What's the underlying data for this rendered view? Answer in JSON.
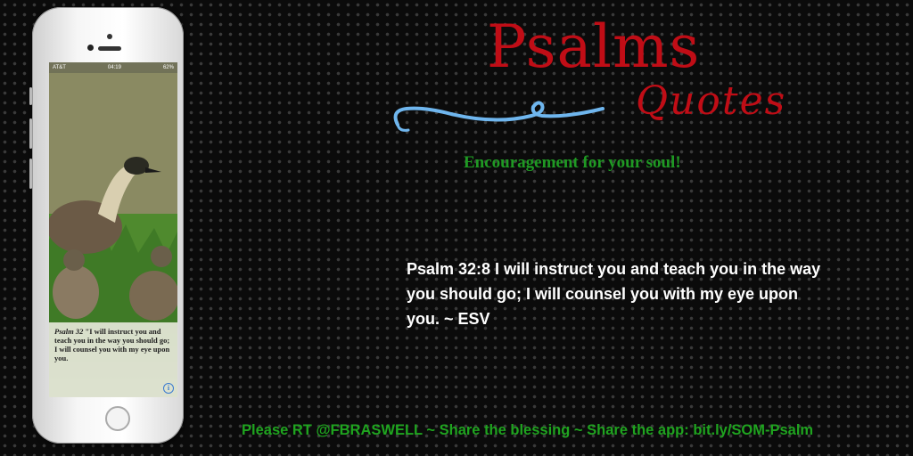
{
  "phone": {
    "carrier": "AT&T",
    "time": "04:19",
    "battery": "62%",
    "caption_ref": "Psalm 32",
    "caption_text": "\"I will instruct you and teach you in the way you should go; I will counsel you with my eye upon you.",
    "info_icon": "info-icon"
  },
  "header": {
    "title": "Psalms",
    "subtitle": "Quotes",
    "tagline": "Encouragement for your soul!"
  },
  "verse": {
    "text": "Psalm 32:8 I will instruct you and teach you in the way you should go; I will counsel you with my eye upon you. ~ ESV"
  },
  "footer": {
    "text": "Please RT @FBRASWELL ~ Share the blessing ~ Share the app: bit.ly/SOM-Psalm"
  },
  "colors": {
    "title_red": "#c00d16",
    "green": "#1fa41f",
    "swirl_blue": "#6fb6ee",
    "background": "#0b0b0b"
  }
}
